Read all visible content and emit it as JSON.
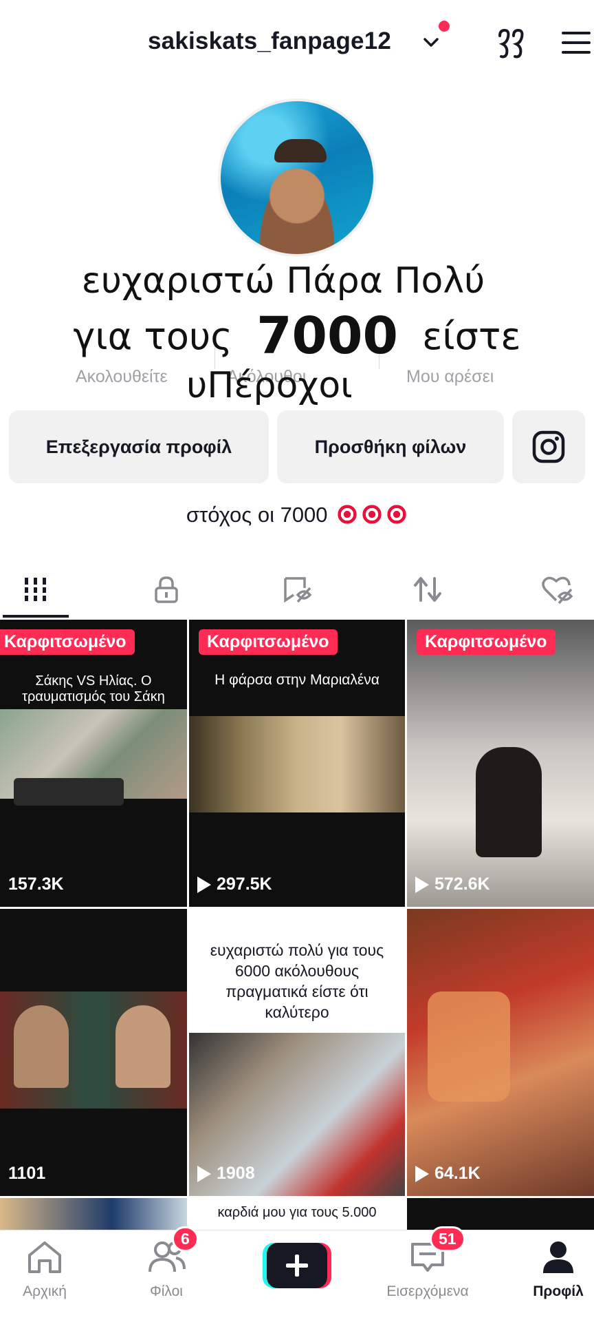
{
  "header": {
    "username": "sakiskats_fanpage12",
    "icons": [
      "chevron-down-icon",
      "creator-tools-icon",
      "menu-icon"
    ]
  },
  "profile": {
    "stats_labels": [
      "Ακολουθείτε",
      "Ακόλουθοι",
      "Μου αρέσει"
    ],
    "bio": "στόχος οι 7000",
    "bio_emoji": "target-emoji"
  },
  "overlay": {
    "line1": "ευχαριστώ Πάρα Πολύ",
    "line2_a": "για τους",
    "line2_num": "7000",
    "line2_b": "είστε",
    "line3": "υΠέροχοι"
  },
  "buttons": {
    "edit_profile": "Επεξεργασία προφίλ",
    "add_friends": "Προσθήκη φίλων"
  },
  "tabs": [
    "grid-icon",
    "lock-icon",
    "saved-icon",
    "repost-icon",
    "liked-icon"
  ],
  "grid": {
    "pinned_label": "Καρφιτσωμένο",
    "videos": [
      {
        "views": "157.3K",
        "pinned": true,
        "caption": "Σάκης VS Ηλίας. Ο τραυματισμός του Σάκη",
        "play": false
      },
      {
        "views": "297.5K",
        "pinned": true,
        "caption": "Η φάρσα στην Μαριαλένα",
        "play": true
      },
      {
        "views": "572.6K",
        "pinned": true,
        "caption": "",
        "play": true
      },
      {
        "views": "1101",
        "pinned": false,
        "caption": "",
        "play": false
      },
      {
        "views": "1908",
        "pinned": false,
        "caption": "ευχαριστώ πολύ για τους 6000 ακόλουθους πραγματικά είστε ότι καλύτερο",
        "play": true
      },
      {
        "views": "64.1K",
        "pinned": false,
        "caption": "",
        "play": true
      }
    ],
    "partial_caption": "καρδιά μου για τους 5.000"
  },
  "bottom_nav": {
    "items": [
      {
        "label": "Αρχική",
        "icon": "home-icon"
      },
      {
        "label": "Φίλοι",
        "icon": "friends-icon",
        "badge": "6"
      },
      {
        "label": "",
        "icon": "create-icon"
      },
      {
        "label": "Εισερχόμενα",
        "icon": "inbox-icon",
        "badge": "51"
      },
      {
        "label": "Προφίλ",
        "icon": "profile-icon"
      }
    ]
  },
  "colors": {
    "accent": "#fe2c55",
    "text": "#161823",
    "muted": "#8a8b91",
    "button_bg": "#f1f1f2"
  }
}
